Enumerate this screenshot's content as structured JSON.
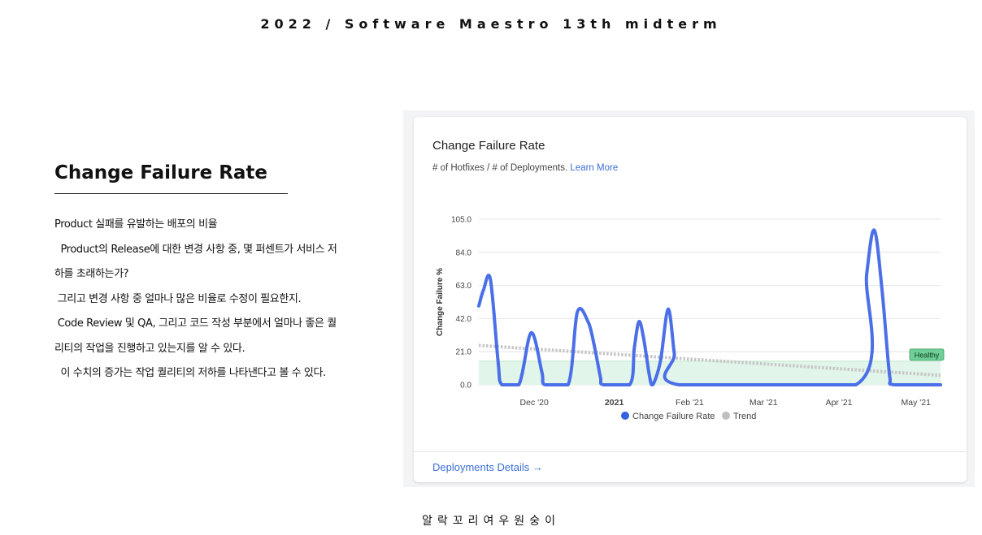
{
  "header": {
    "title": "2022 / Software Maestro 13th midterm"
  },
  "section": {
    "title": "Change Failure Rate",
    "lines": [
      "Product 실패를 유발하는 배포의 비율",
      "  Product의 Release에 대한 변경 사항 중, 몇 퍼센트가 서비스 저",
      "하를 초래하는가?",
      " 그리고 변경 사항 중 얼마나 많은 비율로 수정이 필요한지.",
      " Code Review 및 QA, 그리고 코드 작성 부분에서 얼마나 좋은 퀄",
      "리티의 작업을 진행하고 있는지를 알 수 있다.",
      "  이 수치의 증가는 작업 퀄리티의 저하를 나타낸다고 볼 수 있다."
    ]
  },
  "card": {
    "title": "Change Failure Rate",
    "subtitle": "# of Hotfixes / # of Deployments.",
    "learn_more": "Learn More",
    "link": "Deployments Details →"
  },
  "chart_data": {
    "type": "line",
    "ylabel": "Change Failure %",
    "ylim": [
      0,
      105
    ],
    "yticks": [
      "105.0",
      "84.0",
      "63.0",
      "42.0",
      "21.0",
      "0.0"
    ],
    "xticks": [
      "Dec '20",
      "2021",
      "Feb '21",
      "Mar '21",
      "Apr '21",
      "May '21"
    ],
    "xtick_bold": [
      false,
      true,
      false,
      false,
      false,
      false
    ],
    "healthy_label": "Healthy",
    "healthy_max": 15,
    "legend": [
      {
        "name": "Change Failure Rate",
        "color": "#3461e0"
      },
      {
        "name": "Trend",
        "color": "#c0c0c0"
      }
    ],
    "series": [
      {
        "name": "Change Failure Rate",
        "color": "#4a6fe8",
        "points": [
          [
            0,
            50
          ],
          [
            0.3,
            60
          ],
          [
            0.75,
            67
          ],
          [
            1.25,
            15
          ],
          [
            1.5,
            0
          ],
          [
            2.6,
            0
          ],
          [
            3.4,
            33
          ],
          [
            4.1,
            8
          ],
          [
            4.3,
            0
          ],
          [
            5.8,
            0
          ],
          [
            6.4,
            46
          ],
          [
            7.1,
            40
          ],
          [
            7.5,
            25
          ],
          [
            7.9,
            5
          ],
          [
            8.1,
            0
          ],
          [
            9.8,
            0
          ],
          [
            10.1,
            23
          ],
          [
            10.4,
            40
          ],
          [
            10.7,
            30
          ],
          [
            11.1,
            5
          ],
          [
            11.3,
            0
          ],
          [
            11.8,
            15
          ],
          [
            12.3,
            48
          ],
          [
            12.7,
            20
          ],
          [
            13,
            0
          ],
          [
            24.5,
            0
          ],
          [
            25.2,
            70
          ],
          [
            25.7,
            98
          ],
          [
            26.2,
            60
          ],
          [
            26.7,
            5
          ],
          [
            27,
            0
          ],
          [
            30,
            0
          ]
        ]
      },
      {
        "name": "Trend",
        "color": "#c6c6c6",
        "points": [
          [
            0,
            25
          ],
          [
            30,
            6
          ]
        ]
      }
    ]
  },
  "footer": {
    "text": "알락꼬리여우원숭이"
  }
}
